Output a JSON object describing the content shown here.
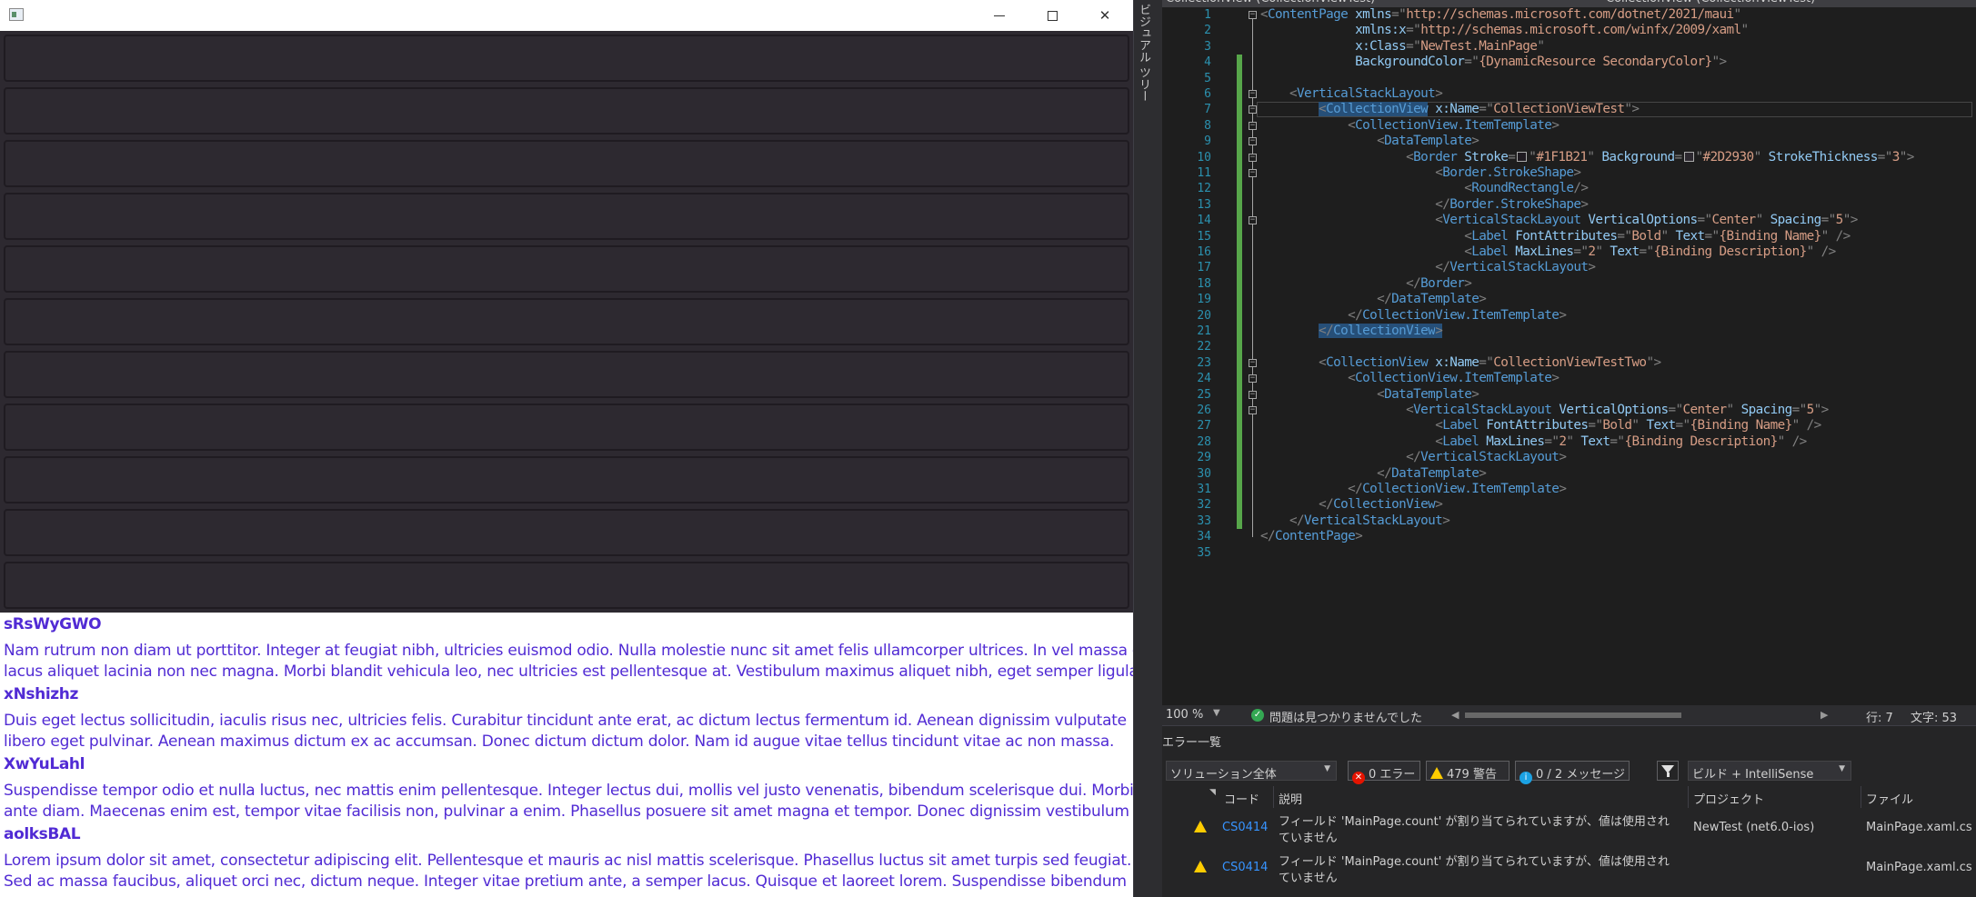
{
  "app": {
    "window_controls": {
      "minimize": "—",
      "maximize": "☐",
      "close": "✕"
    },
    "collection_one_item_count": 11,
    "items": [
      {
        "name": "sRsWyGWO",
        "description": "Nam rutrum non diam ut porttitor. Integer at feugiat nibh, ultricies euismod odio. Nulla molestie nunc sit amet felis ullamcorper ultrices. In vel massa eu\nlacus aliquet lacinia non nec magna. Morbi blandit vehicula leo, nec ultricies est pellentesque at. Vestibulum maximus aliquet nibh, eget semper ligula"
      },
      {
        "name": "xNshizhz",
        "description": "Duis eget lectus sollicitudin, iaculis risus nec, ultricies felis. Curabitur tincidunt ante erat, ac dictum lectus fermentum id. Aenean dignissim vulputate\nlibero eget pulvinar. Aenean maximus dictum ex ac accumsan. Donec dictum dictum dolor. Nam id augue vitae tellus tincidunt vitae ac non massa."
      },
      {
        "name": "XwYuLahl",
        "description": "Suspendisse tempor odio et nulla luctus, nec mattis enim pellentesque. Integer lectus dui, mollis vel justo venenatis, bibendum scelerisque dui. Morbi ac\nante diam. Maecenas enim est, tempor vitae facilisis non, pulvinar a enim. Phasellus posuere sit amet magna et tempor. Donec dignissim vestibulum"
      },
      {
        "name": "aolksBAL",
        "description": "Lorem ipsum dolor sit amet, consectetur adipiscing elit. Pellentesque et mauris ac nisl mattis scelerisque. Phasellus luctus sit amet turpis sed feugiat.\nSed ac massa faucibus, aliquet orci nec, dictum neque. Integer vitae pretium ante, a semper lacus. Quisque et laoreet lorem. Suspendisse bibendum"
      }
    ]
  },
  "vs": {
    "side_label": "ビジュアル ツリー",
    "tabs": [
      "CollectionView (CollectionViewTest)",
      "CollectionView (CollectionViewTest)"
    ],
    "code": [
      {
        "n": "1",
        "seg": [
          [
            "p",
            "<"
          ],
          [
            "t",
            "ContentPage"
          ],
          [
            "s",
            " "
          ],
          [
            "a",
            "xmlns"
          ],
          [
            "p",
            "=\""
          ],
          [
            "v",
            "http://schemas.microsoft.com/dotnet/2021/maui"
          ],
          [
            "p",
            "\""
          ]
        ]
      },
      {
        "n": "2",
        "seg": [
          [
            "s",
            "             "
          ],
          [
            "a",
            "xmlns:x"
          ],
          [
            "p",
            "=\""
          ],
          [
            "v",
            "http://schemas.microsoft.com/winfx/2009/xaml"
          ],
          [
            "p",
            "\""
          ]
        ]
      },
      {
        "n": "3",
        "seg": [
          [
            "s",
            "             "
          ],
          [
            "a",
            "x:Class"
          ],
          [
            "p",
            "=\""
          ],
          [
            "v",
            "NewTest.MainPage"
          ],
          [
            "p",
            "\""
          ]
        ]
      },
      {
        "n": "4",
        "seg": [
          [
            "s",
            "             "
          ],
          [
            "a",
            "BackgroundColor"
          ],
          [
            "p",
            "=\""
          ],
          [
            "v",
            "{DynamicResource SecondaryColor}"
          ],
          [
            "p",
            "\">"
          ]
        ]
      },
      {
        "n": "5",
        "seg": []
      },
      {
        "n": "6",
        "seg": [
          [
            "s",
            "    "
          ],
          [
            "p",
            "<"
          ],
          [
            "t",
            "VerticalStackLayout"
          ],
          [
            "p",
            ">"
          ]
        ]
      },
      {
        "n": "7",
        "seg": [
          [
            "s",
            "        "
          ],
          [
            "ph",
            "<"
          ],
          [
            "th",
            "CollectionView"
          ],
          [
            "s",
            " "
          ],
          [
            "a",
            "x:Name"
          ],
          [
            "p",
            "=\""
          ],
          [
            "v",
            "CollectionViewTest"
          ],
          [
            "p",
            "\">"
          ]
        ]
      },
      {
        "n": "8",
        "seg": [
          [
            "s",
            "            "
          ],
          [
            "p",
            "<"
          ],
          [
            "t",
            "CollectionView.ItemTemplate"
          ],
          [
            "p",
            ">"
          ]
        ]
      },
      {
        "n": "9",
        "seg": [
          [
            "s",
            "                "
          ],
          [
            "p",
            "<"
          ],
          [
            "t",
            "DataTemplate"
          ],
          [
            "p",
            ">"
          ]
        ]
      },
      {
        "n": "10",
        "seg": [
          [
            "s",
            "                    "
          ],
          [
            "p",
            "<"
          ],
          [
            "t",
            "Border"
          ],
          [
            "s",
            " "
          ],
          [
            "a",
            "Stroke"
          ],
          [
            "p",
            "="
          ],
          [
            "sw",
            "#1F1B21"
          ],
          [
            "p",
            "\""
          ],
          [
            "v",
            "#1F1B21"
          ],
          [
            "p",
            "\""
          ],
          [
            "s",
            " "
          ],
          [
            "a",
            "Background"
          ],
          [
            "p",
            "="
          ],
          [
            "sw",
            "#2D2930"
          ],
          [
            "p",
            "\""
          ],
          [
            "v",
            "#2D2930"
          ],
          [
            "p",
            "\""
          ],
          [
            "s",
            " "
          ],
          [
            "a",
            "StrokeThickness"
          ],
          [
            "p",
            "=\""
          ],
          [
            "v",
            "3"
          ],
          [
            "p",
            "\">"
          ]
        ]
      },
      {
        "n": "11",
        "seg": [
          [
            "s",
            "                        "
          ],
          [
            "p",
            "<"
          ],
          [
            "t",
            "Border.StrokeShape"
          ],
          [
            "p",
            ">"
          ]
        ]
      },
      {
        "n": "12",
        "seg": [
          [
            "s",
            "                            "
          ],
          [
            "p",
            "<"
          ],
          [
            "t",
            "RoundRectangle"
          ],
          [
            "p",
            "/>"
          ]
        ]
      },
      {
        "n": "13",
        "seg": [
          [
            "s",
            "                        "
          ],
          [
            "p",
            "</"
          ],
          [
            "t",
            "Border.StrokeShape"
          ],
          [
            "p",
            ">"
          ]
        ]
      },
      {
        "n": "14",
        "seg": [
          [
            "s",
            "                        "
          ],
          [
            "p",
            "<"
          ],
          [
            "t",
            "VerticalStackLayout"
          ],
          [
            "s",
            " "
          ],
          [
            "a",
            "VerticalOptions"
          ],
          [
            "p",
            "=\""
          ],
          [
            "v",
            "Center"
          ],
          [
            "p",
            "\""
          ],
          [
            "s",
            " "
          ],
          [
            "a",
            "Spacing"
          ],
          [
            "p",
            "=\""
          ],
          [
            "v",
            "5"
          ],
          [
            "p",
            "\">"
          ]
        ]
      },
      {
        "n": "15",
        "seg": [
          [
            "s",
            "                            "
          ],
          [
            "p",
            "<"
          ],
          [
            "t",
            "Label"
          ],
          [
            "s",
            " "
          ],
          [
            "a",
            "FontAttributes"
          ],
          [
            "p",
            "=\""
          ],
          [
            "v",
            "Bold"
          ],
          [
            "p",
            "\""
          ],
          [
            "s",
            " "
          ],
          [
            "a",
            "Text"
          ],
          [
            "p",
            "=\""
          ],
          [
            "v",
            "{Binding Name}"
          ],
          [
            "p",
            "\" />"
          ]
        ]
      },
      {
        "n": "16",
        "seg": [
          [
            "s",
            "                            "
          ],
          [
            "p",
            "<"
          ],
          [
            "t",
            "Label"
          ],
          [
            "s",
            " "
          ],
          [
            "a",
            "MaxLines"
          ],
          [
            "p",
            "=\""
          ],
          [
            "v",
            "2"
          ],
          [
            "p",
            "\""
          ],
          [
            "s",
            " "
          ],
          [
            "a",
            "Text"
          ],
          [
            "p",
            "=\""
          ],
          [
            "v",
            "{Binding Description}"
          ],
          [
            "p",
            "\" />"
          ]
        ]
      },
      {
        "n": "17",
        "seg": [
          [
            "s",
            "                        "
          ],
          [
            "p",
            "</"
          ],
          [
            "t",
            "VerticalStackLayout"
          ],
          [
            "p",
            ">"
          ]
        ]
      },
      {
        "n": "18",
        "seg": [
          [
            "s",
            "                    "
          ],
          [
            "p",
            "</"
          ],
          [
            "t",
            "Border"
          ],
          [
            "p",
            ">"
          ]
        ]
      },
      {
        "n": "19",
        "seg": [
          [
            "s",
            "                "
          ],
          [
            "p",
            "</"
          ],
          [
            "t",
            "DataTemplate"
          ],
          [
            "p",
            ">"
          ]
        ]
      },
      {
        "n": "20",
        "seg": [
          [
            "s",
            "            "
          ],
          [
            "p",
            "</"
          ],
          [
            "t",
            "CollectionView.ItemTemplate"
          ],
          [
            "p",
            ">"
          ]
        ]
      },
      {
        "n": "21",
        "seg": [
          [
            "s",
            "        "
          ],
          [
            "ph",
            "</"
          ],
          [
            "th",
            "CollectionView"
          ],
          [
            "ph",
            ">"
          ]
        ]
      },
      {
        "n": "22",
        "seg": []
      },
      {
        "n": "23",
        "seg": [
          [
            "s",
            "        "
          ],
          [
            "p",
            "<"
          ],
          [
            "t",
            "CollectionView"
          ],
          [
            "s",
            " "
          ],
          [
            "a",
            "x:Name"
          ],
          [
            "p",
            "=\""
          ],
          [
            "v",
            "CollectionViewTestTwo"
          ],
          [
            "p",
            "\">"
          ]
        ]
      },
      {
        "n": "24",
        "seg": [
          [
            "s",
            "            "
          ],
          [
            "p",
            "<"
          ],
          [
            "t",
            "CollectionView.ItemTemplate"
          ],
          [
            "p",
            ">"
          ]
        ]
      },
      {
        "n": "25",
        "seg": [
          [
            "s",
            "                "
          ],
          [
            "p",
            "<"
          ],
          [
            "t",
            "DataTemplate"
          ],
          [
            "p",
            ">"
          ]
        ]
      },
      {
        "n": "26",
        "seg": [
          [
            "s",
            "                    "
          ],
          [
            "p",
            "<"
          ],
          [
            "t",
            "VerticalStackLayout"
          ],
          [
            "s",
            " "
          ],
          [
            "a",
            "VerticalOptions"
          ],
          [
            "p",
            "=\""
          ],
          [
            "v",
            "Center"
          ],
          [
            "p",
            "\""
          ],
          [
            "s",
            " "
          ],
          [
            "a",
            "Spacing"
          ],
          [
            "p",
            "=\""
          ],
          [
            "v",
            "5"
          ],
          [
            "p",
            "\">"
          ]
        ]
      },
      {
        "n": "27",
        "seg": [
          [
            "s",
            "                        "
          ],
          [
            "p",
            "<"
          ],
          [
            "t",
            "Label"
          ],
          [
            "s",
            " "
          ],
          [
            "a",
            "FontAttributes"
          ],
          [
            "p",
            "=\""
          ],
          [
            "v",
            "Bold"
          ],
          [
            "p",
            "\""
          ],
          [
            "s",
            " "
          ],
          [
            "a",
            "Text"
          ],
          [
            "p",
            "=\""
          ],
          [
            "v",
            "{Binding Name}"
          ],
          [
            "p",
            "\" />"
          ]
        ]
      },
      {
        "n": "28",
        "seg": [
          [
            "s",
            "                        "
          ],
          [
            "p",
            "<"
          ],
          [
            "t",
            "Label"
          ],
          [
            "s",
            " "
          ],
          [
            "a",
            "MaxLines"
          ],
          [
            "p",
            "=\""
          ],
          [
            "v",
            "2"
          ],
          [
            "p",
            "\""
          ],
          [
            "s",
            " "
          ],
          [
            "a",
            "Text"
          ],
          [
            "p",
            "=\""
          ],
          [
            "v",
            "{Binding Description}"
          ],
          [
            "p",
            "\" />"
          ]
        ]
      },
      {
        "n": "29",
        "seg": [
          [
            "s",
            "                    "
          ],
          [
            "p",
            "</"
          ],
          [
            "t",
            "VerticalStackLayout"
          ],
          [
            "p",
            ">"
          ]
        ]
      },
      {
        "n": "30",
        "seg": [
          [
            "s",
            "                "
          ],
          [
            "p",
            "</"
          ],
          [
            "t",
            "DataTemplate"
          ],
          [
            "p",
            ">"
          ]
        ]
      },
      {
        "n": "31",
        "seg": [
          [
            "s",
            "            "
          ],
          [
            "p",
            "</"
          ],
          [
            "t",
            "CollectionView.ItemTemplate"
          ],
          [
            "p",
            ">"
          ]
        ]
      },
      {
        "n": "32",
        "seg": [
          [
            "s",
            "        "
          ],
          [
            "p",
            "</"
          ],
          [
            "t",
            "CollectionView"
          ],
          [
            "p",
            ">"
          ]
        ]
      },
      {
        "n": "33",
        "seg": [
          [
            "s",
            "    "
          ],
          [
            "p",
            "</"
          ],
          [
            "t",
            "VerticalStackLayout"
          ],
          [
            "p",
            ">"
          ]
        ]
      },
      {
        "n": "34",
        "seg": [
          [
            "p",
            "</"
          ],
          [
            "t",
            "ContentPage"
          ],
          [
            "p",
            ">"
          ]
        ]
      },
      {
        "n": "35",
        "seg": []
      }
    ],
    "status": {
      "zoom": "100 %",
      "issues": "問題は見つかりませんでした",
      "line": "行: 7",
      "col": "文字: 53"
    },
    "errors": {
      "title": "エラー一覧",
      "scope": "ソリューション全体",
      "errors_btn": "0 エラー",
      "warnings_btn": "479 警告",
      "messages_btn": "0 / 2 メッセージ",
      "build_filter": "ビルド + IntelliSense",
      "columns": {
        "code": "コード",
        "desc": "説明",
        "project": "プロジェクト",
        "file": "ファイル"
      },
      "rows": [
        {
          "code": "CS0414",
          "desc": "フィールド 'MainPage.count' が割り当てられていますが、値は使用されていません",
          "project": "NewTest (net6.0-ios)",
          "file": "MainPage.xaml.cs"
        },
        {
          "code": "CS0414",
          "desc": "フィールド 'MainPage.count' が割り当てられていますが、値は使用されていません",
          "project": "",
          "file": "MainPage.xaml.cs"
        }
      ]
    }
  }
}
